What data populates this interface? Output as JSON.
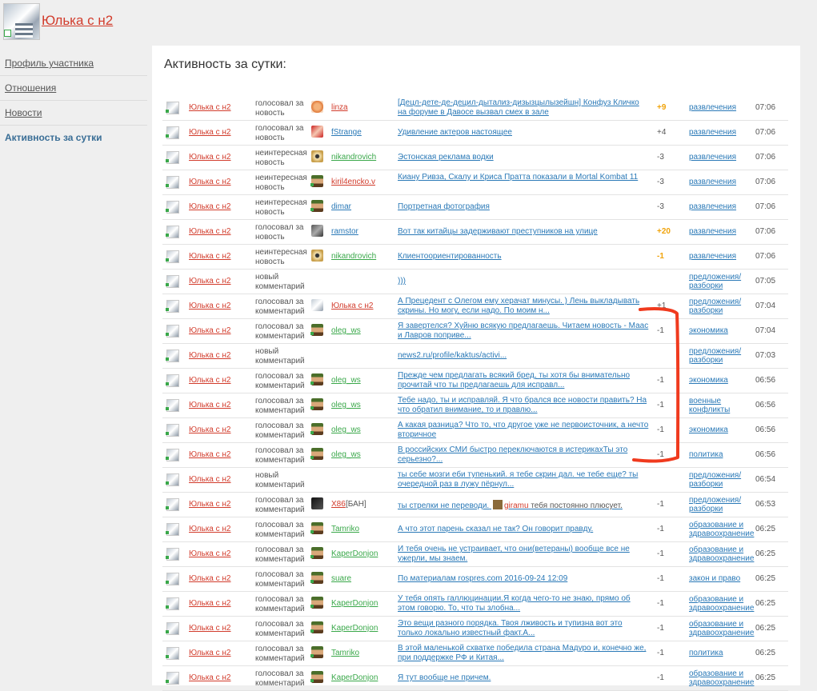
{
  "header": {
    "user_name": "Юлька с н2"
  },
  "sidebar": {
    "items": [
      {
        "label": "Профиль участника"
      },
      {
        "label": "Отношения"
      },
      {
        "label": "Новости"
      },
      {
        "label": "Активность за сутки"
      }
    ]
  },
  "content": {
    "title": "Активность за сутки:"
  },
  "colors": {
    "actor": "#d23c2c",
    "link": "#2a79b7",
    "positive_score": "#f0a30a",
    "annotation": "#f03a1e"
  },
  "feed": [
    {
      "actor": "Юлька с н2",
      "action": "голосовал за новость",
      "target": "linza",
      "target_color": "#d23c2c",
      "target_icon": "orange-circle",
      "post": "[Децл-дете-де-децил-дытализ-дизызцылызейшн] Конфуз Кличко на форуме в Давосе вызвал смех в зале",
      "score": "+9",
      "score_style": "pos",
      "category": "развлечения",
      "time": "07:06"
    },
    {
      "actor": "Юлька с н2",
      "action": "голосовал за новость",
      "target": "fStrange",
      "target_color": "#2a79b7",
      "target_icon": "red-face",
      "post": "Удивление актеров настоящее",
      "score": "+4",
      "score_style": "plain",
      "category": "развлечения",
      "time": "07:06"
    },
    {
      "actor": "Юлька с н2",
      "action": "неинтересная новость",
      "target": "nikandrovich",
      "target_color": "#3aa84a",
      "target_icon": "eye",
      "post": "Эстонская реклама водки",
      "score": "-3",
      "score_style": "plain",
      "category": "развлечения",
      "time": "07:06"
    },
    {
      "actor": "Юлька с н2",
      "action": "неинтересная новость",
      "target": "kiril4encko.v",
      "target_color": "#d23c2c",
      "target_icon": "pixel-face",
      "post": "Киану Ривза, Скалу и Криса Пратта показали в Mortal Kombat 11",
      "score": "-3",
      "score_style": "plain",
      "category": "развлечения",
      "time": "07:06"
    },
    {
      "actor": "Юлька с н2",
      "action": "неинтересная новость",
      "target": "dimar",
      "target_color": "#2a79b7",
      "target_icon": "pixel-face",
      "post": "Портретная фотография",
      "score": "-3",
      "score_style": "plain",
      "category": "развлечения",
      "time": "07:06"
    },
    {
      "actor": "Юлька с н2",
      "action": "голосовал за новость",
      "target": "ramstor",
      "target_color": "#2a79b7",
      "target_icon": "photo",
      "post": "Вот так китайцы задерживают преступников на улице",
      "score": "+20",
      "score_style": "pos",
      "category": "развлечения",
      "time": "07:06"
    },
    {
      "actor": "Юлька с н2",
      "action": "неинтересная новость",
      "target": "nikandrovich",
      "target_color": "#3aa84a",
      "target_icon": "eye",
      "post": "Клиентоориентированность",
      "score": "-1",
      "score_style": "pos",
      "category": "развлечения",
      "time": "07:06"
    },
    {
      "actor": "Юлька с н2",
      "action": "новый комментарий",
      "target": "",
      "target_color": "",
      "target_icon": "",
      "post": ")))",
      "score": "",
      "score_style": "plain",
      "category": "предложения/ разборки",
      "time": "07:05"
    },
    {
      "actor": "Юлька с н2",
      "action": "голосовал за комментарий",
      "target": "Юлька с н2",
      "target_color": "#d23c2c",
      "target_icon": "user",
      "post": "А Прецедент с Олегом ему херачат минусы. ) Лень выкладывать скрины. Но могу, если надо. По моим н...",
      "score": "+1",
      "score_style": "plain",
      "category": "предложения/ разборки",
      "time": "07:04"
    },
    {
      "actor": "Юлька с н2",
      "action": "голосовал за комментарий",
      "target": "oleg_ws",
      "target_color": "#3aa84a",
      "target_icon": "pixel-face",
      "post": "Я завертелся? Хуйню всякую предлагаешь. Читаем новость - Маас и Лавров поприве...",
      "score": "-1",
      "score_style": "plain",
      "category": "экономика",
      "time": "07:04"
    },
    {
      "actor": "Юлька с н2",
      "action": "новый комментарий",
      "target": "",
      "target_color": "",
      "target_icon": "",
      "post": "news2.ru/profile/kaktus/activi...",
      "score": "",
      "score_style": "plain",
      "category": "предложения/ разборки",
      "time": "07:03"
    },
    {
      "actor": "Юлька с н2",
      "action": "голосовал за комментарий",
      "target": "oleg_ws",
      "target_color": "#3aa84a",
      "target_icon": "pixel-face",
      "post": "Прежде чем предлагать всякий бред, ты хотя бы внимательно прочитай что ты предлагаешь для исправл...",
      "score": "-1",
      "score_style": "plain",
      "category": "экономика",
      "time": "06:56"
    },
    {
      "actor": "Юлька с н2",
      "action": "голосовал за комментарий",
      "target": "oleg_ws",
      "target_color": "#3aa84a",
      "target_icon": "pixel-face",
      "post": "Тебе надо, ты и исправляй. Я что брался все новости править? На что обратил внимание, то и правлю...",
      "score": "-1",
      "score_style": "plain",
      "category": "военные конфликты",
      "time": "06:56"
    },
    {
      "actor": "Юлька с н2",
      "action": "голосовал за комментарий",
      "target": "oleg_ws",
      "target_color": "#3aa84a",
      "target_icon": "pixel-face",
      "post": "А какая разница? Что то, что другое уже не первоисточник, а нечто вторичное",
      "score": "-1",
      "score_style": "plain",
      "category": "экономика",
      "time": "06:56"
    },
    {
      "actor": "Юлька с н2",
      "action": "голосовал за комментарий",
      "target": "oleg_ws",
      "target_color": "#3aa84a",
      "target_icon": "pixel-face",
      "post": "В российских СМИ быстро переключаются в истерикахТы это серьезно?...",
      "score": "-1",
      "score_style": "plain",
      "category": "политика",
      "time": "06:56"
    },
    {
      "actor": "Юлька с н2",
      "action": "новый комментарий",
      "target": "",
      "target_color": "",
      "target_icon": "",
      "post": "ты себе мозги еби тупенький. я тебе скрин дал. че тебе еще? ты очередной раз в лужу пёрнул...",
      "score": "",
      "score_style": "plain",
      "category": "предложения/ разборки",
      "time": "06:54"
    },
    {
      "actor": "Юлька с н2",
      "action": "голосовал за комментарий",
      "target": "X86",
      "target_color": "#d23c2c",
      "target_icon": "dark",
      "target_extra": "[БАН]",
      "post": "ты стрелки не переводи.",
      "post_mention": "giramu",
      "post_tail": "тебя постоянно плюсует.",
      "score": "-1",
      "score_style": "plain",
      "category": "предложения/ разборки",
      "time": "06:53"
    },
    {
      "actor": "Юлька с н2",
      "action": "голосовал за комментарий",
      "target": "Tamriko",
      "target_color": "#3aa84a",
      "target_icon": "pixel-face",
      "post": "А что этот парень сказал не так? Он говорит правду.",
      "score": "-1",
      "score_style": "plain",
      "category": "образование и здравоохранение",
      "time": "06:25"
    },
    {
      "actor": "Юлька с н2",
      "action": "голосовал за комментарий",
      "target": "KaperDonjon",
      "target_color": "#3aa84a",
      "target_icon": "pixel-face",
      "post": "И тебя очень не устраивает, что они(ветераны) вообще все не ужерли, мы знаем.",
      "score": "-1",
      "score_style": "plain",
      "category": "образование и здравоохранение",
      "time": "06:25"
    },
    {
      "actor": "Юлька с н2",
      "action": "голосовал за комментарий",
      "target": "suare",
      "target_color": "#3aa84a",
      "target_icon": "pixel-face",
      "post": "По материалам rospres.com 2016-09-24 12:09",
      "score": "-1",
      "score_style": "plain",
      "category": "закон и право",
      "time": "06:25"
    },
    {
      "actor": "Юлька с н2",
      "action": "голосовал за комментарий",
      "target": "KaperDonjon",
      "target_color": "#3aa84a",
      "target_icon": "pixel-face",
      "post": "У тебя опять галлюцинации.Я когда чего-то не знаю, прямо об этом говорю. То, что ты злобна...",
      "score": "-1",
      "score_style": "plain",
      "category": "образование и здравоохранение",
      "time": "06:25"
    },
    {
      "actor": "Юлька с н2",
      "action": "голосовал за комментарий",
      "target": "KaperDonjon",
      "target_color": "#3aa84a",
      "target_icon": "pixel-face",
      "post": "Это вещи разного порядка. Твоя лживость и тупизна вот это только локально известный факт.А...",
      "score": "-1",
      "score_style": "plain",
      "category": "образование и здравоохранение",
      "time": "06:25"
    },
    {
      "actor": "Юлька с н2",
      "action": "голосовал за комментарий",
      "target": "Tamriko",
      "target_color": "#3aa84a",
      "target_icon": "pixel-face",
      "post": "В этой маленькой схватке победила страна Мадуро и, конечно же, при поддержке РФ и Китая...",
      "score": "-1",
      "score_style": "plain",
      "category": "политика",
      "time": "06:25"
    },
    {
      "actor": "Юлька с н2",
      "action": "голосовал за комментарий",
      "target": "KaperDonjon",
      "target_color": "#3aa84a",
      "target_icon": "pixel-face",
      "post": "Я тут вообще не причем.",
      "score": "-1",
      "score_style": "plain",
      "category": "образование и здравоохранение",
      "time": "06:25"
    }
  ]
}
